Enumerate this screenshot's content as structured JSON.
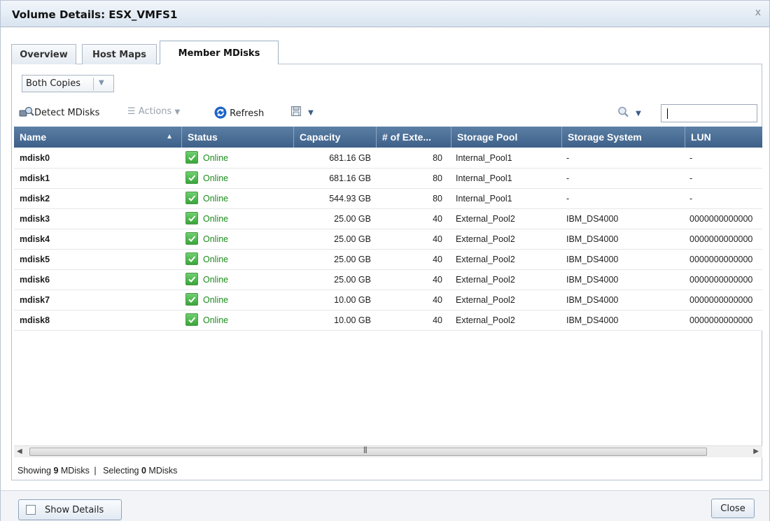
{
  "window": {
    "title": "Volume Details: ESX_VMFS1",
    "close_glyph": "x"
  },
  "tabs": [
    {
      "label": "Overview",
      "active": false
    },
    {
      "label": "Host Maps",
      "active": false
    },
    {
      "label": "Member MDisks",
      "active": true
    }
  ],
  "copies_select": {
    "value": "Both Copies"
  },
  "toolbar": {
    "detect_label": "Detect MDisks",
    "actions_label": "Actions",
    "refresh_label": "Refresh",
    "search_value": ""
  },
  "table": {
    "columns": [
      "Name",
      "Status",
      "Capacity",
      "# of Exte...",
      "Storage Pool",
      "Storage System",
      "LUN"
    ],
    "sorted_column": "Name",
    "rows": [
      {
        "name": "mdisk0",
        "status": "Online",
        "capacity": "681.16 GB",
        "extents": "80",
        "pool": "Internal_Pool1",
        "system": "-",
        "lun": "-"
      },
      {
        "name": "mdisk1",
        "status": "Online",
        "capacity": "681.16 GB",
        "extents": "80",
        "pool": "Internal_Pool1",
        "system": "-",
        "lun": "-"
      },
      {
        "name": "mdisk2",
        "status": "Online",
        "capacity": "544.93 GB",
        "extents": "80",
        "pool": "Internal_Pool1",
        "system": "-",
        "lun": "-"
      },
      {
        "name": "mdisk3",
        "status": "Online",
        "capacity": "25.00 GB",
        "extents": "40",
        "pool": "External_Pool2",
        "system": "IBM_DS4000",
        "lun": "0000000000000"
      },
      {
        "name": "mdisk4",
        "status": "Online",
        "capacity": "25.00 GB",
        "extents": "40",
        "pool": "External_Pool2",
        "system": "IBM_DS4000",
        "lun": "0000000000000"
      },
      {
        "name": "mdisk5",
        "status": "Online",
        "capacity": "25.00 GB",
        "extents": "40",
        "pool": "External_Pool2",
        "system": "IBM_DS4000",
        "lun": "0000000000000"
      },
      {
        "name": "mdisk6",
        "status": "Online",
        "capacity": "25.00 GB",
        "extents": "40",
        "pool": "External_Pool2",
        "system": "IBM_DS4000",
        "lun": "0000000000000"
      },
      {
        "name": "mdisk7",
        "status": "Online",
        "capacity": "10.00 GB",
        "extents": "40",
        "pool": "External_Pool2",
        "system": "IBM_DS4000",
        "lun": "0000000000000"
      },
      {
        "name": "mdisk8",
        "status": "Online",
        "capacity": "10.00 GB",
        "extents": "40",
        "pool": "External_Pool2",
        "system": "IBM_DS4000",
        "lun": "0000000000000"
      }
    ]
  },
  "statusbar": {
    "showing_prefix": "Showing",
    "showing_count": "9",
    "showing_suffix": "MDisks",
    "separator": "|",
    "selecting_prefix": "Selecting",
    "selecting_count": "0",
    "selecting_suffix": "MDisks"
  },
  "footer": {
    "show_details_label": "Show Details",
    "close_label": "Close"
  },
  "colors": {
    "header": "#4a6d95",
    "online": "#1a8c1a",
    "refresh_icon": "#1c64c8"
  }
}
